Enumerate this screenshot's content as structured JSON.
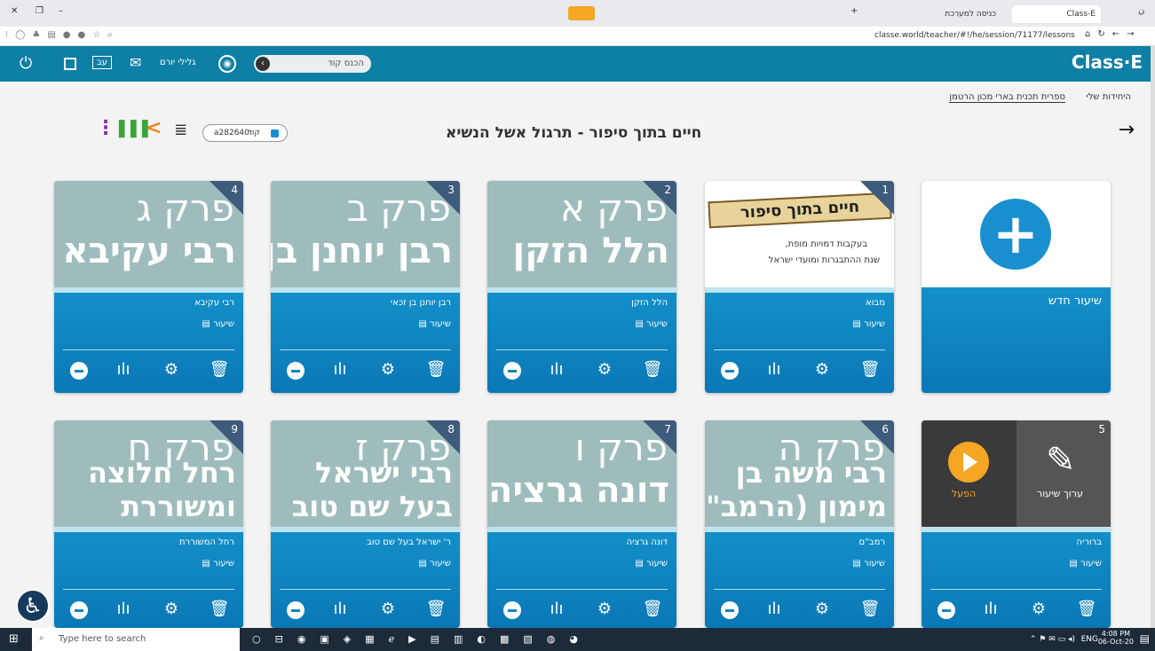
{
  "browser": {
    "tabs": [
      {
        "label": "Class-E"
      },
      {
        "label": "כניסה למערכת"
      }
    ],
    "url": "classe.world/teacher/#!/he/session/71177/lessons"
  },
  "appbar": {
    "brand": "Class·E",
    "code_placeholder": "הכנס קוד",
    "user_name": "גלילי יורם",
    "lang": "עב"
  },
  "nav": {
    "my_units": "היחידות שלי",
    "library": "ספרית תכנית בארי מכון הרטמן"
  },
  "header": {
    "title": "חיים בתוך סיפור - תרגול אשל הנשיא",
    "code_label": "קוד",
    "code_value": "a282640"
  },
  "new_lesson": {
    "label": "שיעור חדש"
  },
  "lessons": [
    {
      "num": "1",
      "name": "מבוא",
      "type": "שיעור",
      "thumb_title": "חיים בתוך סיפור",
      "thumb_sub1": "בעקבות דמויות מופת,",
      "thumb_sub2": "שנת ההתבגרות ומועדי ישראל"
    },
    {
      "num": "2",
      "name": "הלל הזקן",
      "type": "שיעור",
      "t1": "פרק א",
      "t2": "הלל הזקן"
    },
    {
      "num": "3",
      "name": "רבן יוחנן בן זכאי",
      "type": "שיעור",
      "t1": "פרק ב",
      "t2": "רבן יוחנן בן זכאי"
    },
    {
      "num": "4",
      "name": "רבי עקיבא",
      "type": "שיעור",
      "t1": "פרק ג",
      "t2": "רבי עקיבא"
    },
    {
      "num": "5",
      "name": "ברוריה",
      "type": "שיעור",
      "play": "הפעל",
      "edit": "ערוך שיעור"
    },
    {
      "num": "6",
      "name": "רמב\"ם",
      "type": "שיעור",
      "t1": "פרק ה",
      "t2": "רבי משה בן",
      "t3": "מימון (הרמב\"ם)"
    },
    {
      "num": "7",
      "name": "דונה גרציה",
      "type": "שיעור",
      "t1": "פרק ו",
      "t2": "דונה גרציה"
    },
    {
      "num": "8",
      "name": "ר' ישראל בעל שם טוב",
      "type": "שיעור",
      "t1": "פרק ז",
      "t2": "רבי ישראל",
      "t3": "בעל שם טוב"
    },
    {
      "num": "9",
      "name": "רחל המשוררת",
      "type": "שיעור",
      "t1": "פרק ח",
      "t2": "רחל חלוצה",
      "t3": "ומשוררת"
    }
  ],
  "taskbar": {
    "search_placeholder": "Type here to search",
    "time": "4:08 PM",
    "date": "06-Oct-20",
    "lang": "ENG"
  },
  "colors": {
    "appbar": "#0e7fa5",
    "card": "#1590cf",
    "accent": "#f5a623"
  }
}
